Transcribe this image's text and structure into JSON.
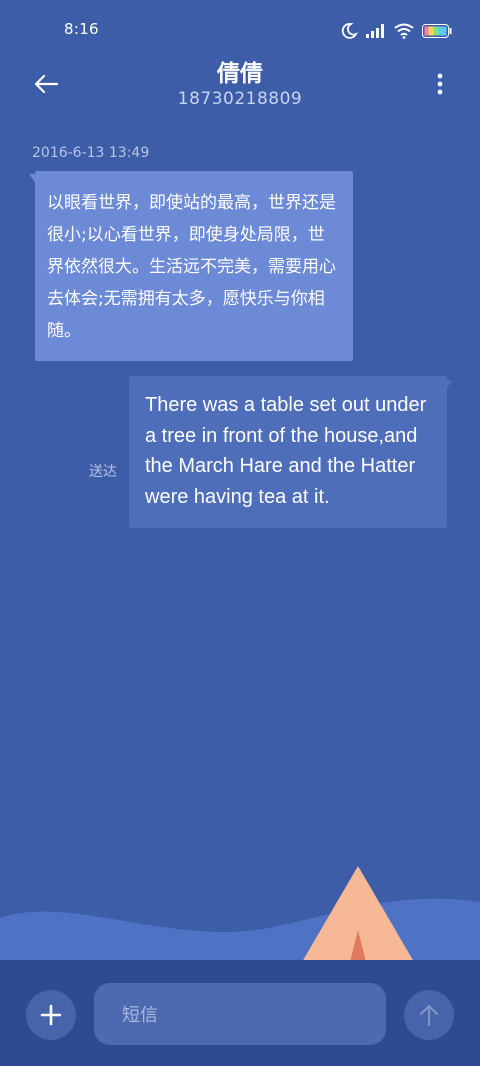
{
  "status_bar": {
    "time": "8:16",
    "icons": [
      "moon-icon",
      "signal-icon",
      "wifi-icon",
      "battery-icon"
    ]
  },
  "header": {
    "contact_name": "倩倩",
    "contact_number": "18730218809",
    "back_icon": "arrow-left-icon",
    "menu_icon": "more-vertical-icon"
  },
  "conversation": {
    "timestamp": "2016-6-13 13:49",
    "messages": [
      {
        "direction": "incoming",
        "text": "以眼看世界，即使站的最高，世界还是很小;以心看世界，即使身处局限，世界依然很大。生活远不完美，需要用心去体会;无需拥有太多，愿快乐与你相随。"
      },
      {
        "direction": "outgoing",
        "text": "There was a table set out under a tree in front of the house,and the March Hare and the Hatter were having tea at it.",
        "status": "送达"
      }
    ]
  },
  "composer": {
    "placeholder": "短信",
    "add_icon": "plus-icon",
    "send_icon": "arrow-up-icon"
  },
  "colors": {
    "background": "#3d5da8",
    "incoming_bubble": "#6c8ad6",
    "outgoing_bubble": "#4f6eba",
    "bottom_bar": "#2f4a91",
    "tent": "#f6b895"
  }
}
